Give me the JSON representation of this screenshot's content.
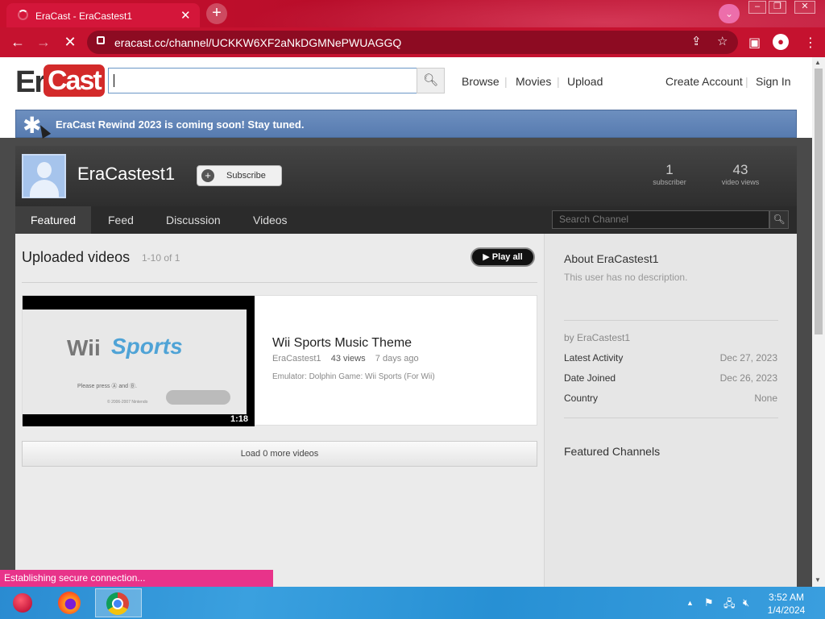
{
  "browser": {
    "tab_title": "EraCast - EraCastest1",
    "url": "eracast.cc/channel/UCKKW6XF2aNkDGMNePWUAGGQ"
  },
  "site": {
    "logo_era": "Era",
    "logo_cast": "Cast",
    "nav": {
      "browse": "Browse",
      "movies": "Movies",
      "upload": "Upload",
      "create_account": "Create Account",
      "sign_in": "Sign In"
    },
    "banner": "EraCast Rewind 2023 is coming soon! Stay tuned."
  },
  "channel": {
    "name": "EraCastest1",
    "subscribe_label": "Subscribe",
    "subscribers": "1",
    "subscribers_label": "subscriber",
    "views": "43",
    "views_label": "video views",
    "tabs": [
      "Featured",
      "Feed",
      "Discussion",
      "Videos"
    ],
    "search_placeholder": "Search Channel"
  },
  "uploads": {
    "title": "Uploaded videos",
    "count": "1-10 of 1",
    "play_all": "Play all",
    "load_more": "Load 0 more videos",
    "video": {
      "title": "Wii Sports Music Theme",
      "author": "EraCastest1",
      "views": "43 views",
      "age": "7 days ago",
      "description": "Emulator: Dolphin Game: Wii Sports (For Wii)",
      "duration": "1:18",
      "thumb_wii": "Wii",
      "thumb_sports": "Sports",
      "thumb_press": "Please press Ⓐ and Ⓑ.",
      "thumb_copy": "© 2006-2007 Nintendo"
    }
  },
  "about": {
    "title": "About EraCastest1",
    "description": "This user has no description.",
    "by": "by EraCastest1",
    "rows": [
      {
        "label": "Latest Activity",
        "value": "Dec 27, 2023"
      },
      {
        "label": "Date Joined",
        "value": "Dec 26, 2023"
      },
      {
        "label": "Country",
        "value": "None"
      }
    ],
    "featured_channels": "Featured Channels"
  },
  "status_bar": "Establishing secure connection...",
  "taskbar": {
    "time": "3:52 AM",
    "date": "1/4/2024"
  },
  "colors": {
    "chrome": "#c5122f",
    "banner": "#577bb0",
    "logo_red": "#d32a2a",
    "status": "#e8338a"
  }
}
